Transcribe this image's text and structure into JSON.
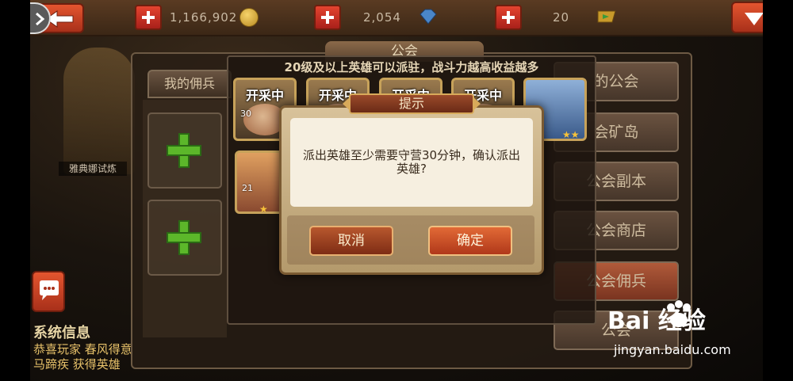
{
  "topbar": {
    "gold": "1,166,902",
    "gems": "2,054",
    "tickets": "20"
  },
  "guild": {
    "title": "公会",
    "tab_mine": "我的佣兵",
    "menu": [
      "的公会",
      "会矿岛",
      "公会副本",
      "公会商店",
      "公会佣兵",
      "公会"
    ]
  },
  "dispatch": {
    "hint": "20级及以上英雄可以派驻，战斗力越高收益越多",
    "hero_state": "开采中",
    "hero_levels": [
      "30",
      "21"
    ]
  },
  "left": {
    "name_plate": "雅典娜试炼",
    "sys_title": "系统信息",
    "sys_msg": "恭喜玩家 春风得意马蹄疾 获得英雄"
  },
  "dialog": {
    "title": "提示",
    "message": "派出英雄至少需要守营30分钟，确认派出英雄?",
    "cancel": "取消",
    "ok": "确定"
  },
  "watermark": {
    "logo": "Bai  经验",
    "url": "jingyan.baidu.com"
  },
  "colors": {
    "accent_red": "#e4552f",
    "gold": "#c7a25a",
    "dialog_bg": "#f6efe0"
  }
}
